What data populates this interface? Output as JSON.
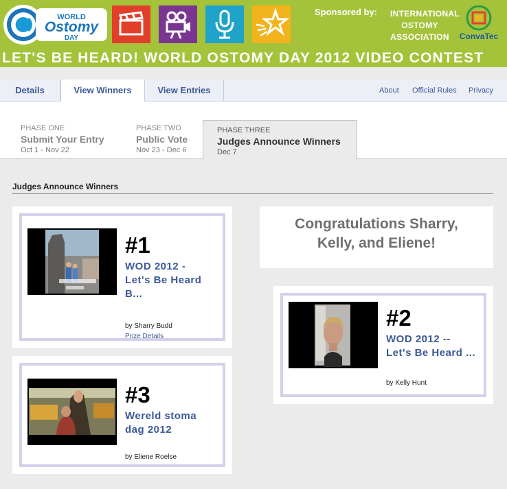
{
  "banner": {
    "logo_line1": "WORLD",
    "logo_line2": "Ostomy",
    "logo_line3": "DAY",
    "sponsored_label": "Sponsored by:",
    "sponsor1_lines": [
      "INTERNATIONAL",
      "OSTOMY",
      "ASSOCIATION"
    ],
    "sponsor2": "ConvaTec",
    "headline": "LET'S BE HEARD! WORLD OSTOMY DAY 2012 VIDEO CONTEST",
    "category_icons": [
      "clapperboard-icon",
      "movie-camera-icon",
      "microphone-icon",
      "star-icon"
    ],
    "colors": {
      "banner": "#a5c33a",
      "clapper": "#e23f2b",
      "camera": "#7a3592",
      "mic": "#1fa3c9",
      "star": "#f2b31c"
    }
  },
  "tabs": {
    "details": "Details",
    "winners": "View Winners",
    "entries": "View Entries",
    "active": "View Winners"
  },
  "links": {
    "about": "About",
    "rules": "Official Rules",
    "privacy": "Privacy"
  },
  "phases": [
    {
      "kicker": "PHASE ONE",
      "title": "Submit Your Entry",
      "dates": "Oct 1 - Nov 22"
    },
    {
      "kicker": "PHASE TWO",
      "title": "Public Vote",
      "dates": "Nov 23 - Dec 6"
    },
    {
      "kicker": "PHASE THREE",
      "title": "Judges Announce Winners",
      "dates": "Dec 7"
    }
  ],
  "section_title": "Judges Announce Winners",
  "congrats": {
    "line1": "Congratulations Sharry,",
    "line2": "Kelly, and Eliene!"
  },
  "winners": [
    {
      "rank": "#1",
      "title_lines": [
        "WOD 2012 -",
        "Let's Be Heard",
        "B..."
      ],
      "author": "by Sharry Budd",
      "prize_link": "Prize Details"
    },
    {
      "rank": "#2",
      "title_lines": [
        "WOD 2012 --",
        "Let's Be Heard ..."
      ],
      "author": "by Kelly Hunt"
    },
    {
      "rank": "#3",
      "title_lines": [
        "Wereld stoma",
        "dag 2012"
      ],
      "author": "by Eliene Roelse"
    }
  ]
}
